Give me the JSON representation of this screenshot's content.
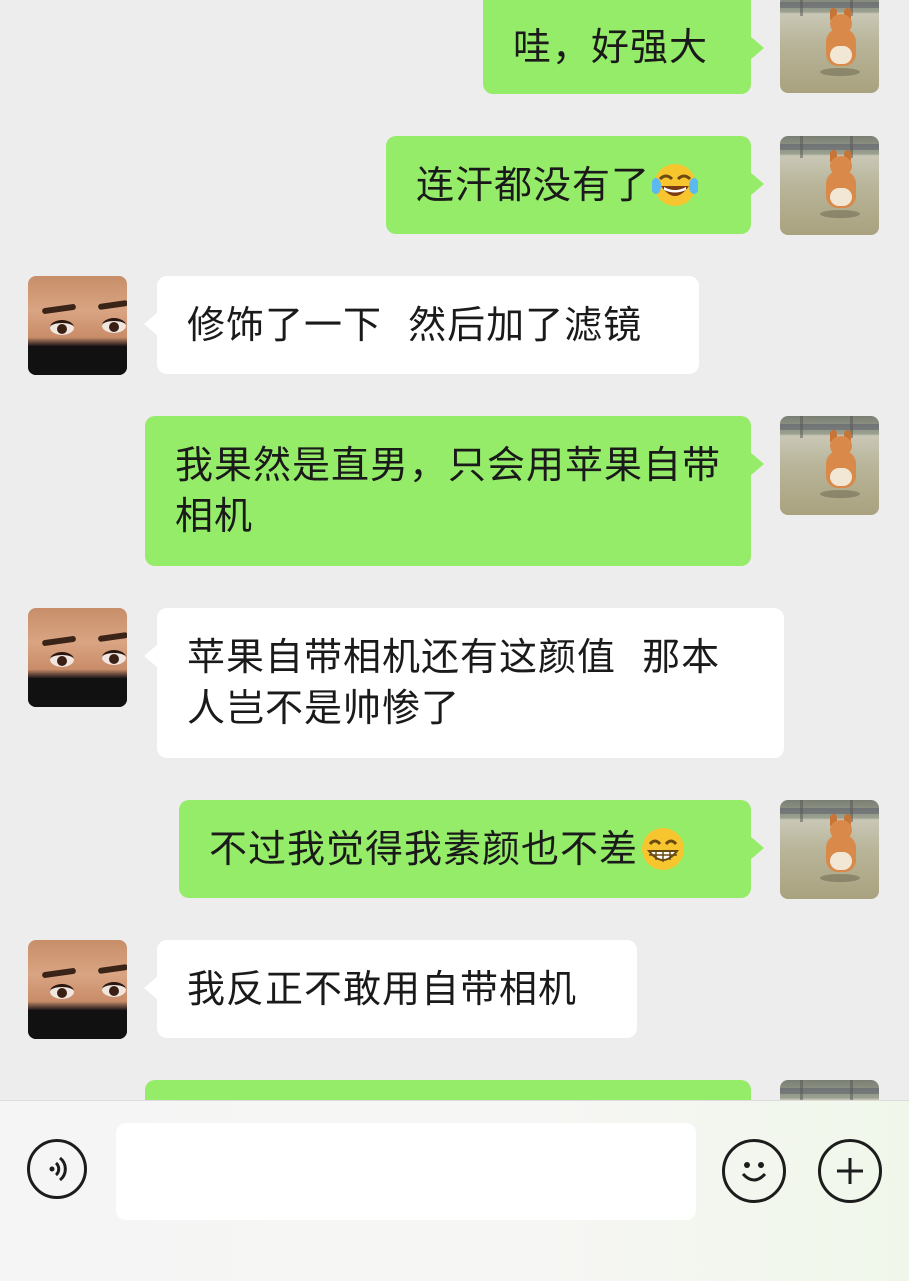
{
  "messages": [
    {
      "side": "me",
      "text": "哇，好强大",
      "emoji": ""
    },
    {
      "side": "me",
      "text": "连汗都没有了",
      "emoji": "laugh-cry"
    },
    {
      "side": "them",
      "text": "修饰了一下  然后加了滤镜",
      "emoji": ""
    },
    {
      "side": "me",
      "text": "我果然是直男，只会用苹果自带相机",
      "emoji": ""
    },
    {
      "side": "them",
      "text": "苹果自带相机还有这颜值  那本人岂不是帅惨了",
      "emoji": ""
    },
    {
      "side": "me",
      "text": "不过我觉得我素颜也不差",
      "emoji": "grin"
    },
    {
      "side": "them",
      "text": "我反正不敢用自带相机",
      "emoji": ""
    },
    {
      "side": "me",
      "text": "",
      "emoji": ""
    }
  ],
  "input": {
    "value": "",
    "placeholder": ""
  },
  "icons": {
    "voice": "voice-icon",
    "emoji": "emoji-icon",
    "plus": "plus-icon",
    "laugh": "laugh-cry-emoji-icon",
    "grin": "grin-emoji-icon"
  },
  "colors": {
    "sent_bubble": "#95ec69",
    "received_bubble": "#ffffff",
    "background": "#ededed"
  }
}
